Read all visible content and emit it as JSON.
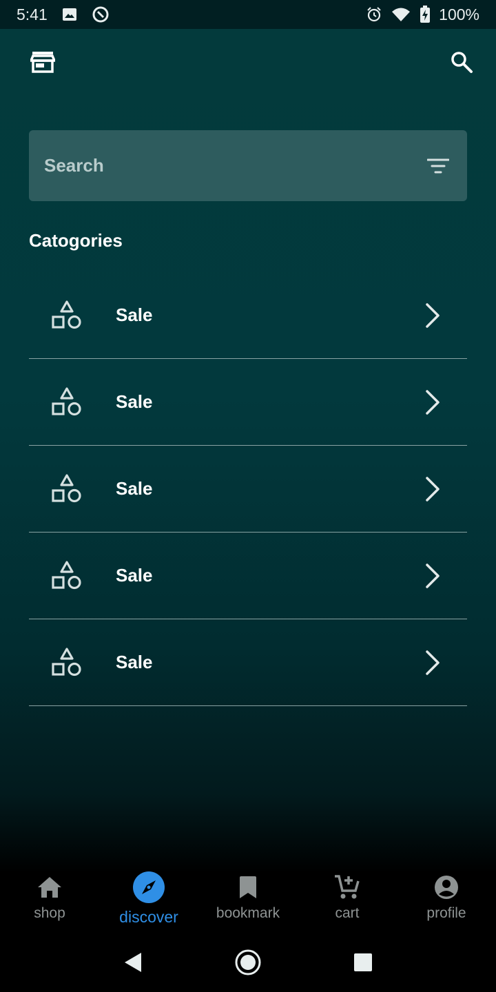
{
  "status_bar": {
    "time": "5:41",
    "battery": "100%",
    "icons": [
      "image-icon",
      "sync-icon",
      "alarm-icon",
      "wifi-icon",
      "battery-charging-icon"
    ]
  },
  "app_bar": {
    "left_icon": "store-icon",
    "right_icon": "search-icon"
  },
  "search": {
    "placeholder": "Search",
    "value": "",
    "filter_icon": "filter-icon"
  },
  "categories": {
    "heading": "Catogories",
    "items": [
      {
        "label": "Sale",
        "icon": "shapes-icon"
      },
      {
        "label": "Sale",
        "icon": "shapes-icon"
      },
      {
        "label": "Sale",
        "icon": "shapes-icon"
      },
      {
        "label": "Sale",
        "icon": "shapes-icon"
      },
      {
        "label": "Sale",
        "icon": "shapes-icon"
      }
    ]
  },
  "bottom_nav": {
    "items": [
      {
        "label": "shop",
        "icon": "home-icon",
        "active": false
      },
      {
        "label": "discover",
        "icon": "compass-icon",
        "active": true
      },
      {
        "label": "bookmark",
        "icon": "bookmark-icon",
        "active": false
      },
      {
        "label": "cart",
        "icon": "cart-icon",
        "active": false
      },
      {
        "label": "profile",
        "icon": "account-icon",
        "active": false
      }
    ]
  },
  "colors": {
    "background_top": "#033a3c",
    "search_field": "#2e5c5e",
    "accent": "#2f8fe6",
    "inactive_nav": "#8e9393"
  }
}
